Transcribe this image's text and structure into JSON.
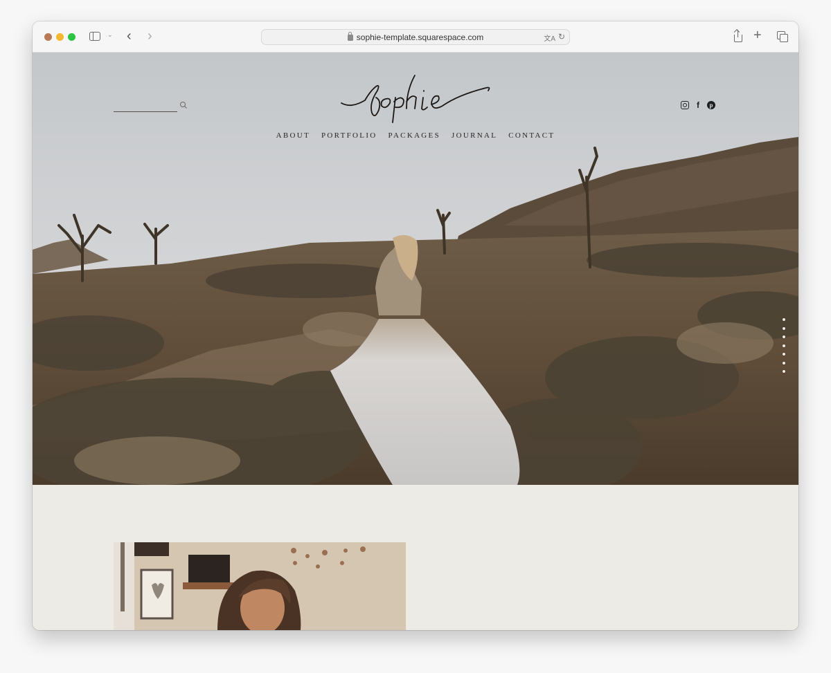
{
  "browser": {
    "url": "sophie-template.squarespace.com",
    "icons": {
      "sidebar": "sidebar-icon",
      "back": "chevron-left-icon",
      "forward": "chevron-right-icon",
      "lock": "lock-icon",
      "translate": "translate-icon",
      "reload": "reload-icon",
      "share": "share-icon",
      "new_tab": "plus-icon",
      "tabs": "tab-overview-icon"
    },
    "glyphs": {
      "back": "‹",
      "forward": "›",
      "chevron_down": "⌄",
      "reload": "↻",
      "plus": "+",
      "translate": "文A"
    }
  },
  "site": {
    "logo_text": "sophie",
    "search": {
      "placeholder": ""
    },
    "nav": [
      {
        "label": "ABOUT"
      },
      {
        "label": "PORTFOLIO"
      },
      {
        "label": "PACKAGES"
      },
      {
        "label": "JOURNAL"
      },
      {
        "label": "CONTACT"
      }
    ],
    "social": [
      {
        "name": "instagram",
        "glyph": ""
      },
      {
        "name": "facebook",
        "glyph": "f"
      },
      {
        "name": "pinterest",
        "glyph": "p"
      }
    ],
    "hero": {
      "image_description": "Bride in flowing tulle gown walking through desert with Joshua trees at dusk",
      "slide_count": 7,
      "active_slide": 1
    },
    "about": {
      "image_description": "Woman with shoulder-length hair in a cozy room with hanging dried flowers"
    }
  },
  "colors": {
    "page_bg": "#ecebe6",
    "text": "#2a2622",
    "toolbar": "#f6f6f6"
  }
}
